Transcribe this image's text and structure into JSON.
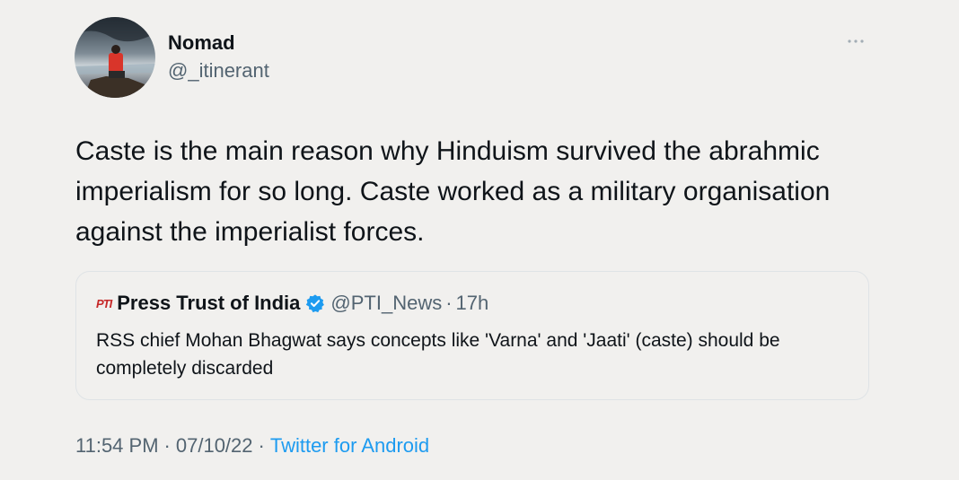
{
  "author": {
    "display_name": "Nomad",
    "handle": "@_itinerant"
  },
  "more_icon": "more-horizontal-icon",
  "tweet": {
    "text": "Caste is the main reason why Hinduism survived the abrahmic imperialism for so long. Caste worked as a military organisation against the imperialist forces."
  },
  "quote": {
    "logo_text": "PTI",
    "name": "Press Trust of India",
    "verified_icon": "verified-badge-icon",
    "handle": "@PTI_News",
    "separator": "·",
    "time": "17h",
    "text": "RSS chief Mohan Bhagwat says concepts like 'Varna' and 'Jaati' (caste) should be completely discarded"
  },
  "meta": {
    "time": "11:54 PM",
    "date": "07/10/22",
    "separator": "·",
    "source": "Twitter for Android"
  },
  "colors": {
    "background": "#f1f0ee",
    "text": "#0f1419",
    "secondary": "#536471",
    "link": "#1d9bf0",
    "verified": "#1d9bf0"
  }
}
